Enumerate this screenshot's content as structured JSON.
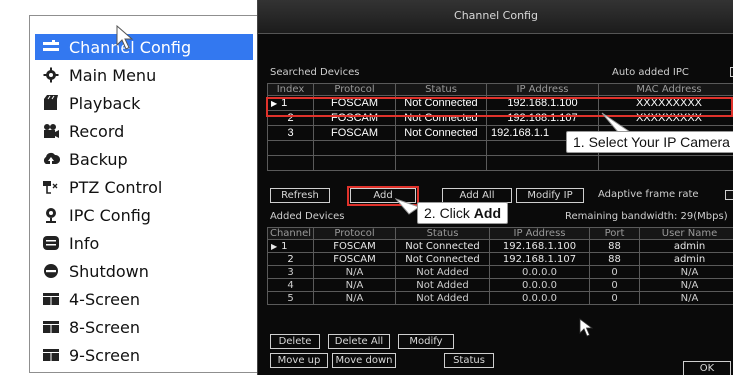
{
  "menu": {
    "items": [
      {
        "label": "Channel Config",
        "icon": "channel-config-icon",
        "active": true
      },
      {
        "label": "Main Menu",
        "icon": "gear-icon"
      },
      {
        "label": "Playback",
        "icon": "playback-icon"
      },
      {
        "label": "Record",
        "icon": "record-icon"
      },
      {
        "label": "Backup",
        "icon": "backup-icon"
      },
      {
        "label": "PTZ Control",
        "icon": "ptz-icon"
      },
      {
        "label": "IPC Config",
        "icon": "ipc-icon"
      },
      {
        "label": "Info",
        "icon": "info-icon"
      },
      {
        "label": "Shutdown",
        "icon": "power-icon"
      },
      {
        "label": "4-Screen",
        "icon": "screen-layout-icon"
      },
      {
        "label": "8-Screen",
        "icon": "screen-layout-icon"
      },
      {
        "label": "9-Screen",
        "icon": "screen-layout-icon"
      }
    ]
  },
  "dialog": {
    "title": "Channel Config",
    "searched_label": "Searched Devices",
    "auto_add_label": "Auto added IPC",
    "searched_columns": [
      "Index",
      "Protocol",
      "Status",
      "IP Address",
      "MAC Address"
    ],
    "searched_rows": [
      {
        "index": "1",
        "protocol": "FOSCAM",
        "status": "Not Connected",
        "ip": "192.168.1.100",
        "mac": "XXXXXXXXX",
        "selected": true
      },
      {
        "index": "2",
        "protocol": "FOSCAM",
        "status": "Not Connected",
        "ip": "192.168.1.107",
        "mac": "XXXXXXXXX"
      },
      {
        "index": "3",
        "protocol": "FOSCAM",
        "status": "Not Connected",
        "ip": "192.168.1.1",
        "mac": ""
      }
    ],
    "buttons_top": {
      "refresh": "Refresh",
      "add": "Add",
      "add_all": "Add All",
      "modify_ip": "Modify IP"
    },
    "adaptive_label": "Adaptive frame rate",
    "added_label": "Added Devices",
    "bandwidth_label": "Remaining bandwidth: 29(Mbps)",
    "added_columns": [
      "Channel",
      "Protocol",
      "Status",
      "IP Address",
      "Port",
      "User Name"
    ],
    "added_rows": [
      {
        "channel": "1",
        "protocol": "FOSCAM",
        "status": "Not Connected",
        "ip": "192.168.1.100",
        "port": "88",
        "user": "admin",
        "selected": true
      },
      {
        "channel": "2",
        "protocol": "FOSCAM",
        "status": "Not Connected",
        "ip": "192.168.1.107",
        "port": "88",
        "user": "admin"
      },
      {
        "channel": "3",
        "protocol": "N/A",
        "status": "Not Added",
        "ip": "0.0.0.0",
        "port": "0",
        "user": "N/A"
      },
      {
        "channel": "4",
        "protocol": "N/A",
        "status": "Not Added",
        "ip": "0.0.0.0",
        "port": "0",
        "user": "N/A"
      },
      {
        "channel": "5",
        "protocol": "N/A",
        "status": "Not Added",
        "ip": "0.0.0.0",
        "port": "0",
        "user": "N/A"
      }
    ],
    "buttons_bottom": {
      "delete": "Delete",
      "delete_all": "Delete All",
      "modify": "Modify",
      "move_up": "Move up",
      "move_down": "Move down",
      "status": "Status",
      "ok": "OK"
    }
  },
  "callouts": {
    "step1": "1. Select Your IP Camera",
    "step2_prefix": "2. Click ",
    "step2_bold": "Add"
  },
  "colors": {
    "highlight": "#e0322b",
    "menu_active": "#3378f0"
  }
}
